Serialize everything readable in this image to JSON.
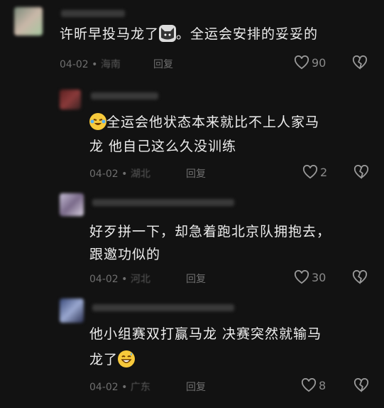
{
  "colors": {
    "background": "#121212",
    "text": "#ededed",
    "meta": "#6f6f6f",
    "emoji_yellow": "#f7c93b"
  },
  "comments": [
    {
      "text_before": "许昕早投马龙了",
      "emoji": "cat-face-icon",
      "text_after": "。全运会安排的妥妥的",
      "date": "04-02",
      "location": "海南",
      "reply_label": "回复",
      "likes": "90"
    },
    {
      "emoji": "crying-laughing-emoji",
      "line1": "全运会他状态本来就比不上人家马",
      "line2": "龙  他自己这么久没训练",
      "date": "04-02",
      "location": "湖北",
      "reply_label": "回复",
      "likes": "2"
    },
    {
      "line1": "好歹拼一下，却急着跑北京队拥抱去，",
      "line2": "跟邀功似的",
      "date": "04-02",
      "location": "河北",
      "reply_label": "回复",
      "likes": "30"
    },
    {
      "line1": "他小组赛双打赢马龙 决赛突然就输马",
      "line2_before": "龙了",
      "emoji": "grinning-sweat-emoji",
      "date": "04-02",
      "location": "广东",
      "reply_label": "回复",
      "likes": "8"
    }
  ]
}
